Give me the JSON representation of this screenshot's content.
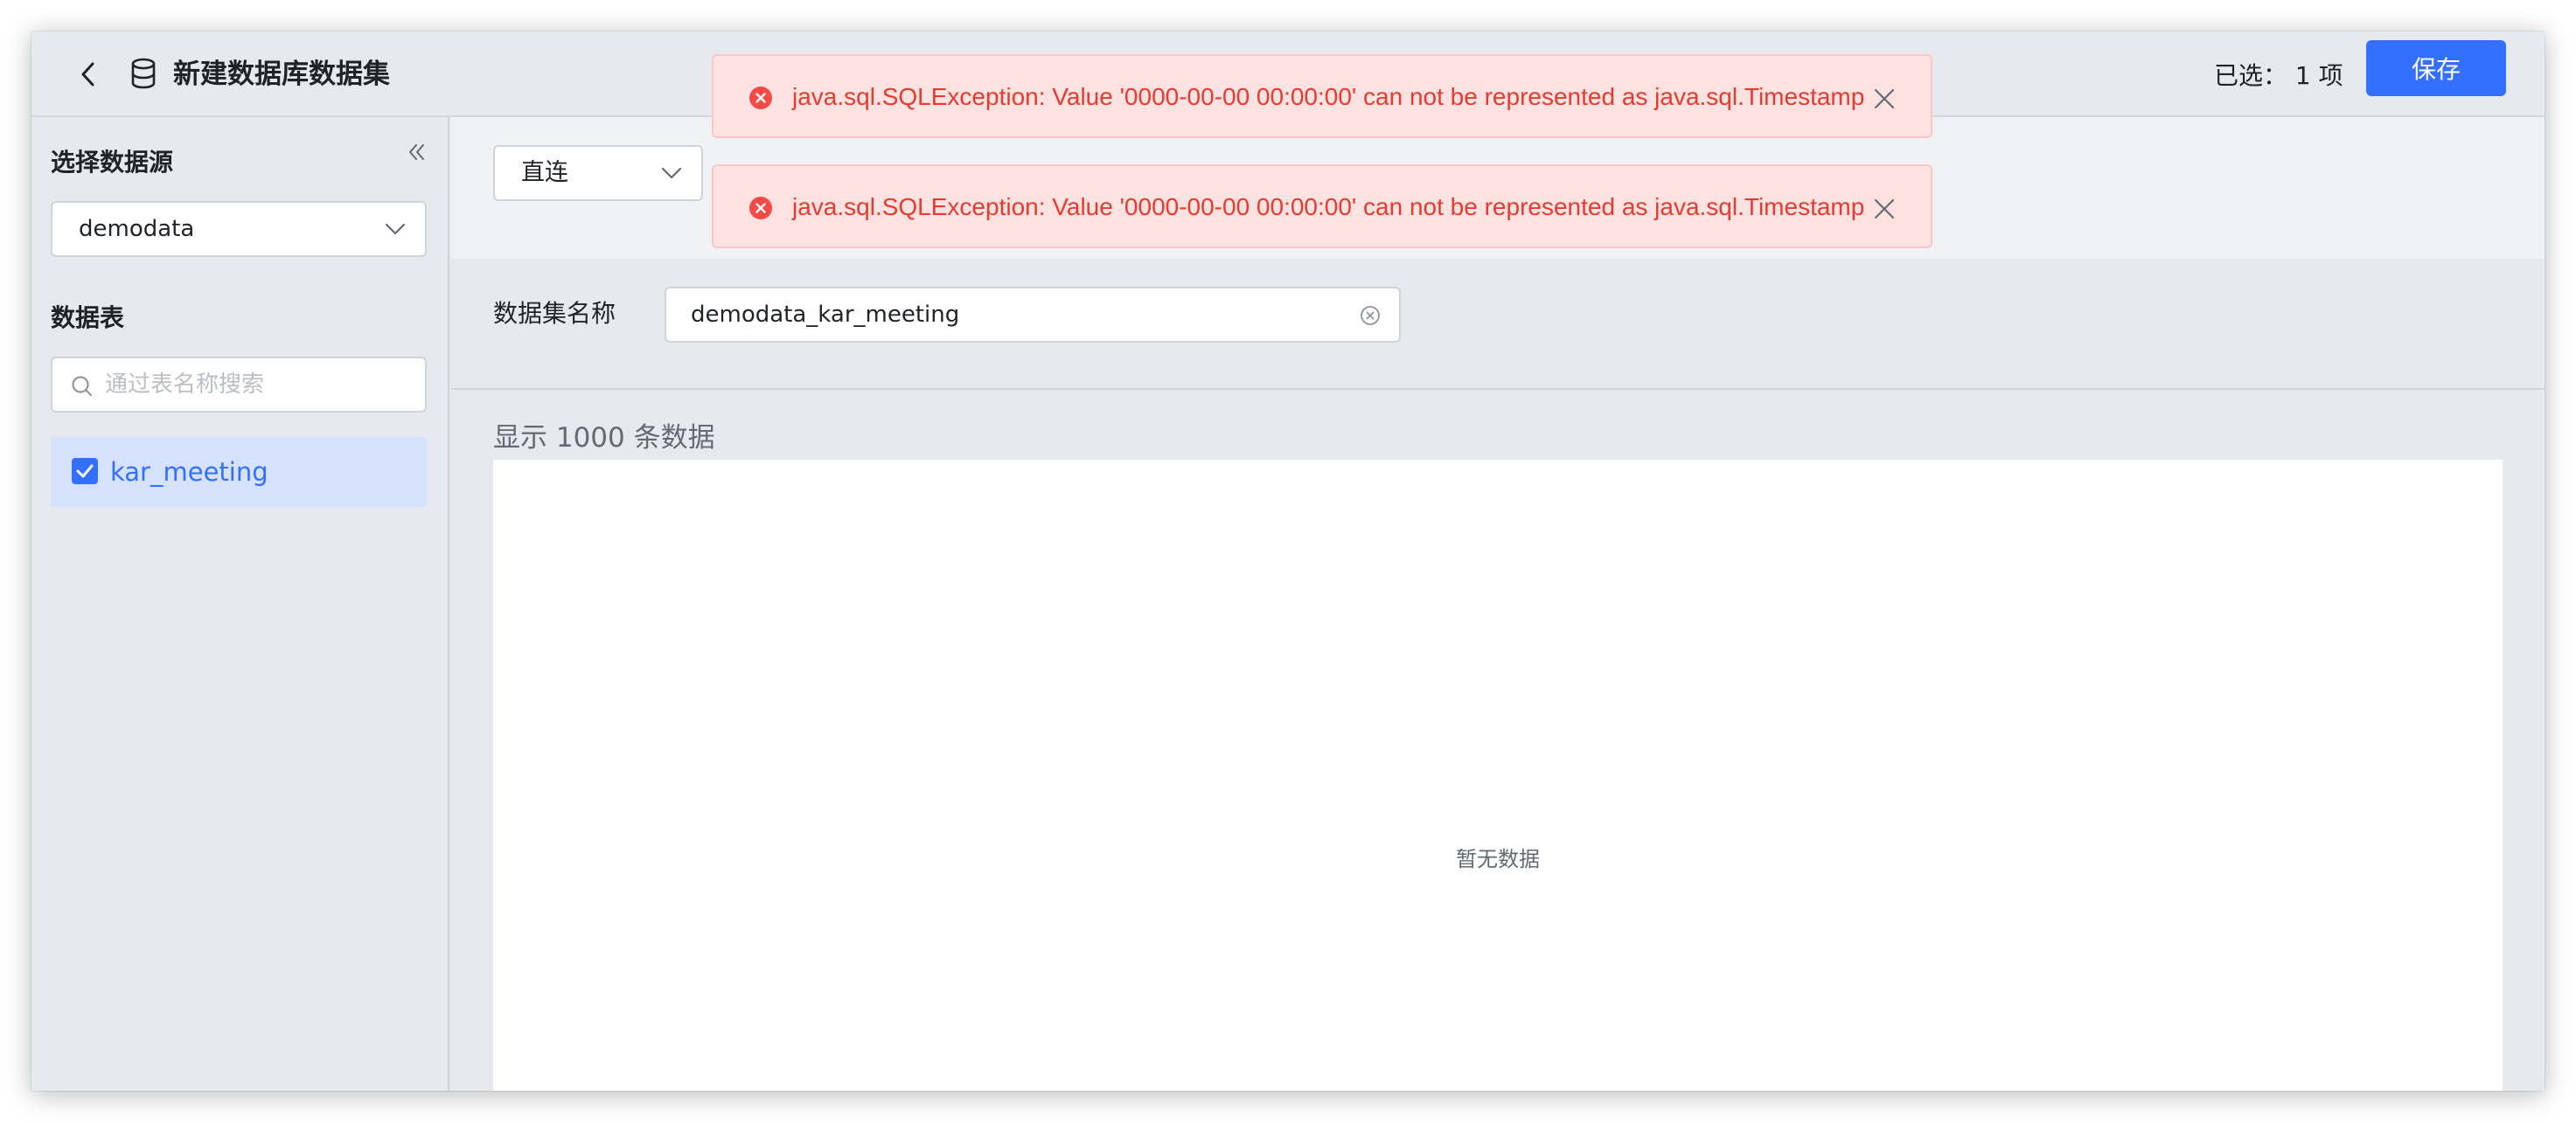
{
  "header": {
    "title": "新建数据库数据集",
    "selected_label": "已选：",
    "selected_count": "1 项",
    "save_label": "保存"
  },
  "sidebar": {
    "datasource_title": "选择数据源",
    "datasource_value": "demodata",
    "tables_title": "数据表",
    "search_placeholder": "通过表名称搜索",
    "tables": [
      {
        "label": "kar_meeting",
        "checked": true
      }
    ]
  },
  "main": {
    "mode_value": "直连",
    "name_label": "数据集名称",
    "name_value": "demodata_kar_meeting",
    "preview_label": "显示 1000 条数据",
    "empty_text": "暂无数据"
  },
  "toasts": [
    {
      "message": "java.sql.SQLException: Value '0000-00-00 00:00:00' can not be represented as java.sql.Timestamp"
    },
    {
      "message": "java.sql.SQLException: Value '0000-00-00 00:00:00' can not be represented as java.sql.Timestamp"
    }
  ],
  "colors": {
    "primary": "#3370ff",
    "error": "#e63b2e",
    "error_bg": "#fde2e1"
  }
}
